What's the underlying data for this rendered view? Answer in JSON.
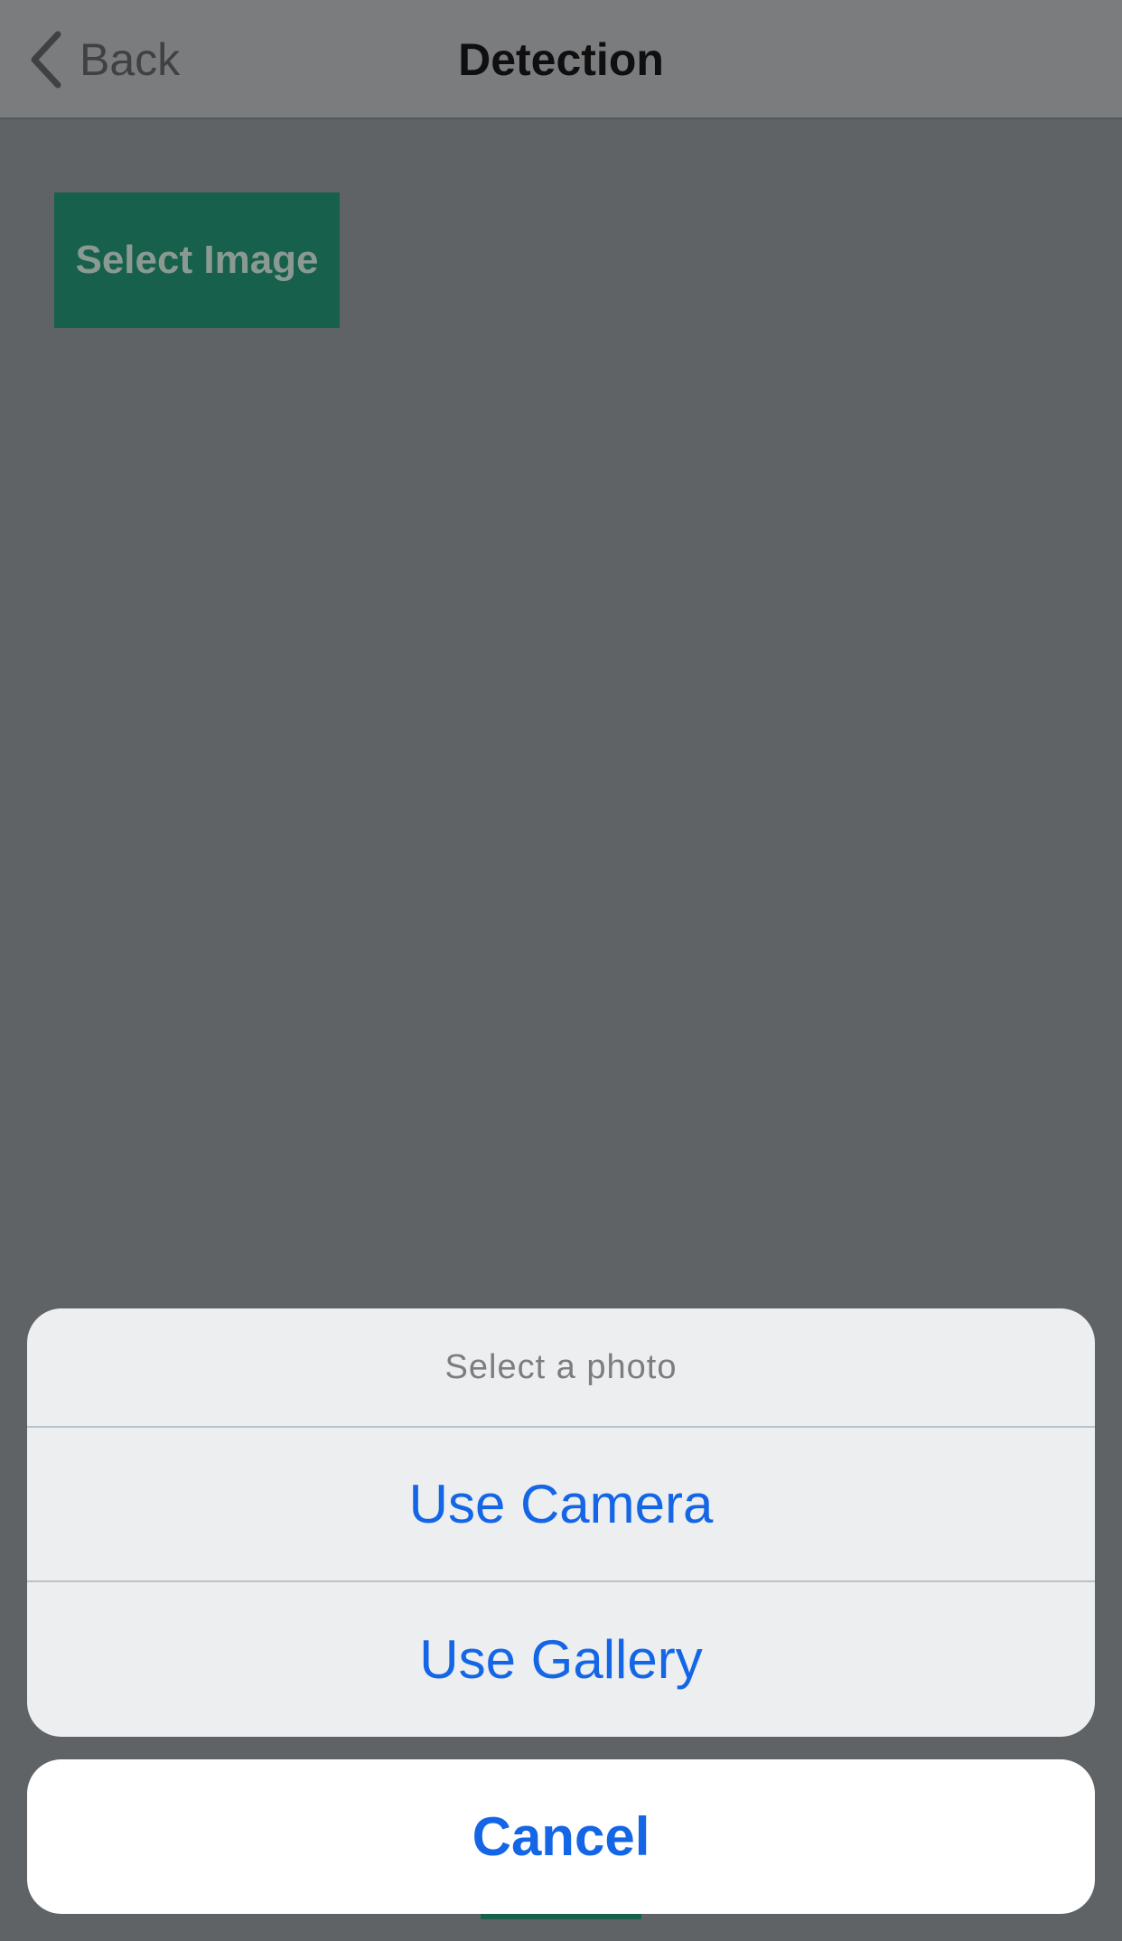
{
  "navbar": {
    "back_label": "Back",
    "title": "Detection"
  },
  "content": {
    "select_image_label": "Select Image"
  },
  "action_sheet": {
    "title": "Select a photo",
    "options": [
      {
        "label": "Use Camera"
      },
      {
        "label": "Use Gallery"
      }
    ],
    "cancel_label": "Cancel"
  },
  "colors": {
    "accent_blue": "#1466e6",
    "button_green": "#17604b",
    "overlay_background": "#5f6366"
  },
  "icons": {
    "back": "chevron-left-icon"
  }
}
